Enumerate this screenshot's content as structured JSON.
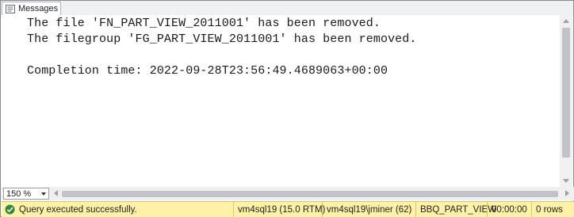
{
  "tab": {
    "label": "Messages",
    "icon": "messages-icon"
  },
  "messages": {
    "lines": [
      "The file 'FN_PART_VIEW_2011001' has been removed.",
      "The filegroup 'FG_PART_VIEW_2011001' has been removed.",
      "Completion time: 2022-09-28T23:56:49.4689063+00:00"
    ]
  },
  "zoom": {
    "value": "150 %"
  },
  "status": {
    "message": "Query executed successfully.",
    "server": "vm4sql19 (15.0 RTM)",
    "user": "vm4sql19\\jminer (62)",
    "database": "BBQ_PART_VIEW",
    "elapsed": "00:00:00",
    "rows": "0 rows",
    "bar_color": "#fff2a8"
  }
}
